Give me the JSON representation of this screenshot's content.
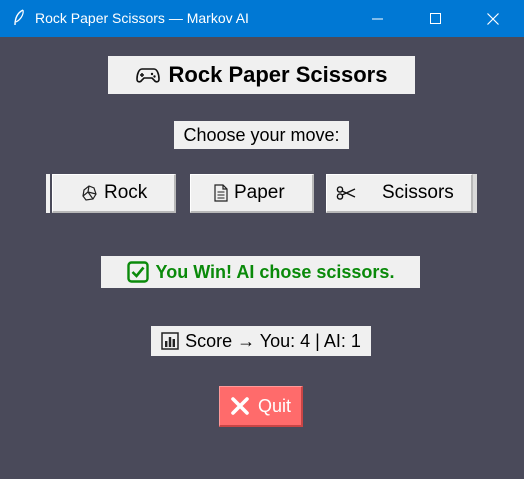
{
  "window": {
    "title": "Rock Paper Scissors — Markov AI",
    "controls": {
      "minimize": "minimize-icon",
      "maximize": "maximize-icon",
      "close": "close-icon"
    }
  },
  "header": {
    "title": "Rock Paper Scissors",
    "icon": "gamepad-icon"
  },
  "prompt": "Choose your move:",
  "moves": [
    {
      "label": "Rock",
      "icon": "rock-icon"
    },
    {
      "label": "Paper",
      "icon": "page-icon"
    },
    {
      "label": "Scissors",
      "icon": "scissors-icon"
    }
  ],
  "result": {
    "text": "You Win! AI chose scissors.",
    "icon": "check-box-icon",
    "color": "#0a8a0a"
  },
  "score": {
    "text": "Score → You: 4 | AI: 1",
    "icon": "bar-chart-icon"
  },
  "quit": {
    "label": "Quit",
    "icon": "x-icon",
    "color": "#ff6b6b"
  },
  "colors": {
    "background": "#4a4a5a",
    "titlebar": "#0078d4",
    "panel": "#f0f0f0"
  }
}
